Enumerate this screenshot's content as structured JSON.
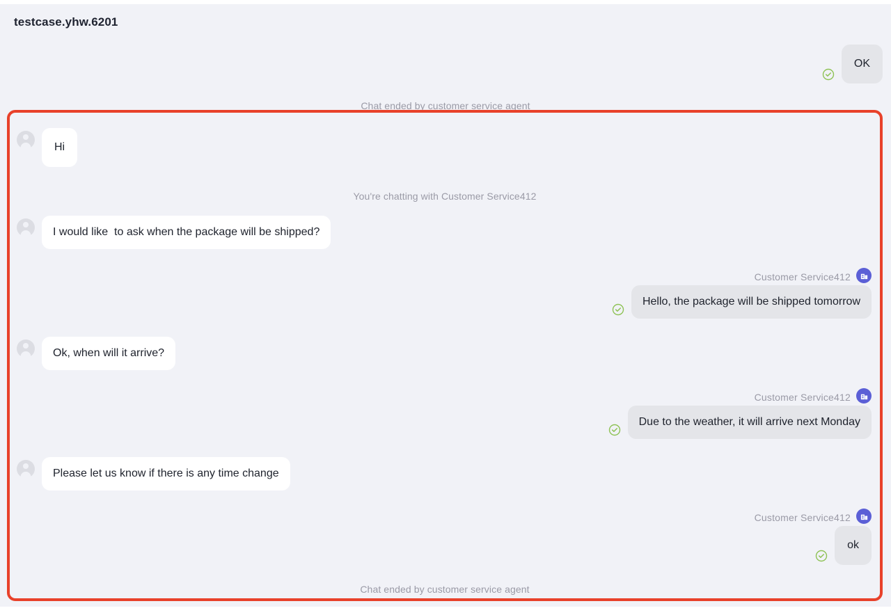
{
  "header": {
    "title": "testcase.yhw.6201"
  },
  "colors": {
    "background": "#f1f2f7",
    "highlight_border": "#e8412a",
    "agent_bubble": "#e4e5e9",
    "user_bubble": "#ffffff",
    "agent_avatar": "#5b5fd6",
    "check_green": "#7cb342",
    "muted_text": "#9a9aa6"
  },
  "icons": {
    "user_avatar": "person-avatar-icon",
    "agent_avatar": "store-building-icon",
    "sent_check": "check-circle-icon"
  },
  "outer_conversation": {
    "messages": [
      {
        "id": "outer-agent-ok",
        "side": "right",
        "sender": "agent",
        "text": "OK",
        "has_check": true
      }
    ],
    "notice": "Chat ended by customer service agent"
  },
  "highlighted_conversation": {
    "messages": [
      {
        "id": "msg-user-hi",
        "side": "left",
        "sender": "user",
        "text": "Hi",
        "has_check": false
      },
      {
        "id": "msg-user-shipped",
        "side": "left",
        "sender": "user",
        "text": "I would like  to ask when the package will be shipped?",
        "has_check": false
      },
      {
        "id": "msg-agent-tomorrow",
        "side": "right",
        "sender": "agent",
        "sender_name": "Customer Service412",
        "text": "Hello, the package will be shipped tomorrow",
        "has_check": true
      },
      {
        "id": "msg-user-arrive",
        "side": "left",
        "sender": "user",
        "text": "Ok, when will it arrive?",
        "has_check": false
      },
      {
        "id": "msg-agent-monday",
        "side": "right",
        "sender": "agent",
        "sender_name": "Customer Service412",
        "text": "Due to the weather, it will arrive next Monday",
        "has_check": true
      },
      {
        "id": "msg-user-timechange",
        "side": "left",
        "sender": "user",
        "text": "Please let us know if there is any time change",
        "has_check": false
      },
      {
        "id": "msg-agent-ok",
        "side": "right",
        "sender": "agent",
        "sender_name": "Customer Service412",
        "text": "ok",
        "has_check": true
      }
    ],
    "chatting_notice": "You're chatting with Customer Service412",
    "ended_notice": "Chat ended by customer service agent"
  }
}
